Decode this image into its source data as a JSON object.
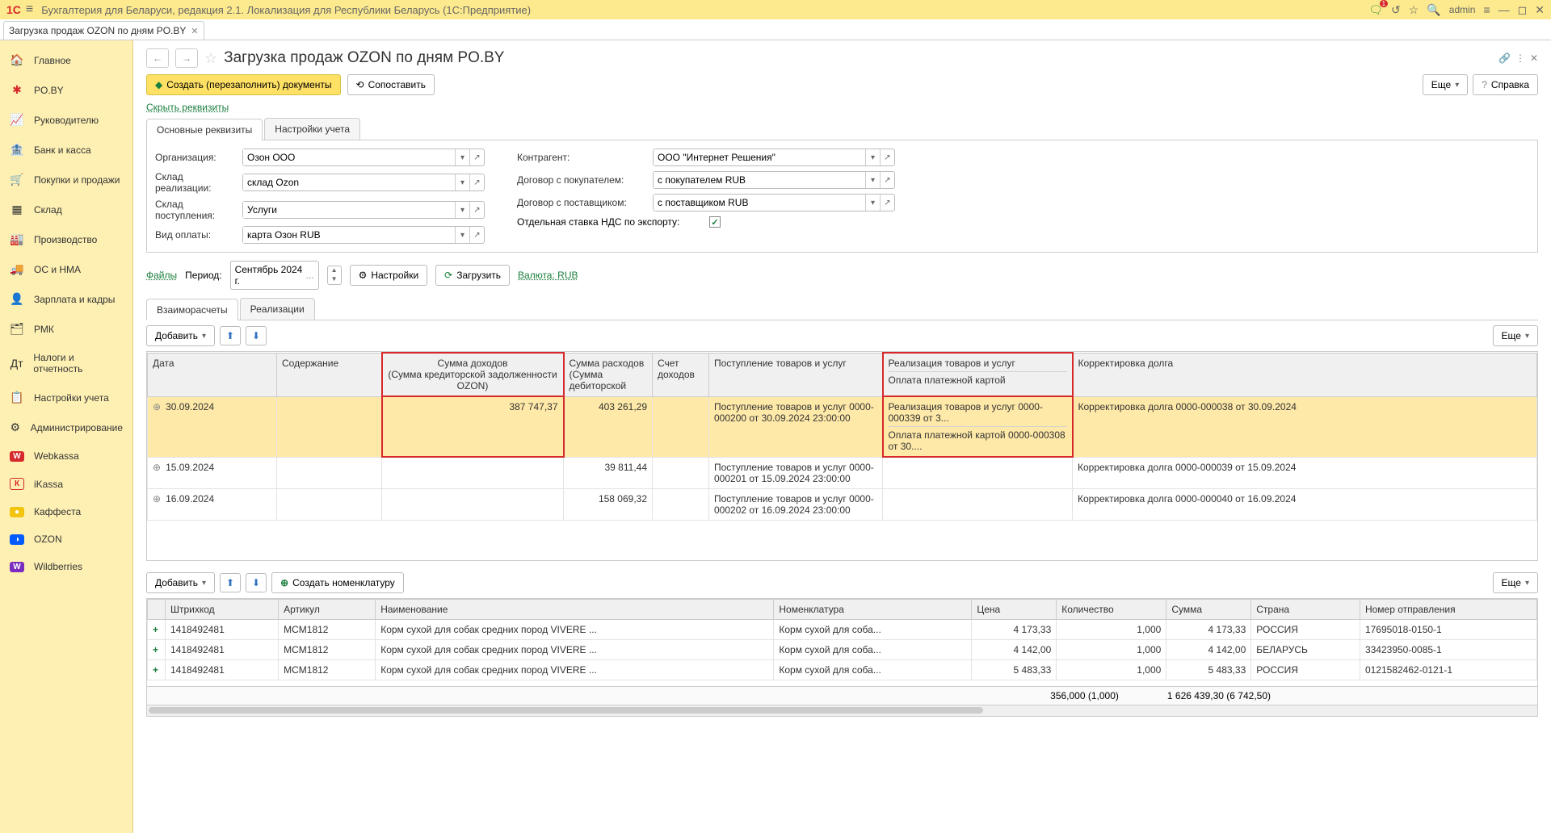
{
  "titlebar": {
    "logo": "1C",
    "title": "Бухгалтерия для Беларуси, редакция 2.1. Локализация для Республики Беларусь   (1С:Предприятие)",
    "user": "admin",
    "notif_count": "1"
  },
  "doc_tab": {
    "title": "Загрузка продаж OZON по дням PO.BY"
  },
  "sidebar": [
    {
      "icon": "🏠",
      "label": "Главное"
    },
    {
      "icon": "✱",
      "label": "PO.BY",
      "accent": "#d6292b"
    },
    {
      "icon": "📈",
      "label": "Руководителю"
    },
    {
      "icon": "🏦",
      "label": "Банк и касса"
    },
    {
      "icon": "🛒",
      "label": "Покупки и продажи"
    },
    {
      "icon": "▦",
      "label": "Склад"
    },
    {
      "icon": "🏭",
      "label": "Производство"
    },
    {
      "icon": "🚚",
      "label": "ОС и НМА"
    },
    {
      "icon": "👤",
      "label": "Зарплата и кадры"
    },
    {
      "icon": "🗂",
      "label": "РМК"
    },
    {
      "icon": "Дт",
      "label": "Налоги и отчетность"
    },
    {
      "icon": "📋",
      "label": "Настройки учета"
    },
    {
      "icon": "⚙",
      "label": "Администрирование"
    },
    {
      "icon": "W",
      "label": "Webkassa",
      "bg": "#d6292b"
    },
    {
      "icon": "К",
      "label": "iKassa",
      "bg": "#e67e22",
      "clr": "#d6292b"
    },
    {
      "icon": "●",
      "label": "Каффеста",
      "bg": "#f3c40f"
    },
    {
      "icon": "◑",
      "label": "OZON",
      "bg": "#005bff"
    },
    {
      "icon": "W",
      "label": "Wildberries",
      "bg": "#7b2cbf"
    }
  ],
  "page": {
    "title": "Загрузка продаж OZON по дням PO.BY",
    "btn_create": "Создать (перезаполнить) документы",
    "btn_compare": "Сопоставить",
    "btn_more": "Еще",
    "btn_help": "Справка",
    "link_hide": "Скрыть реквизиты",
    "link_files": "Файлы",
    "link_currency": "Валюта: RUB"
  },
  "subtabs": [
    "Основные реквизиты",
    "Настройки учета"
  ],
  "form_left": [
    {
      "label": "Организация:",
      "value": "Озон ООО"
    },
    {
      "label": "Склад реализации:",
      "value": "склад Ozon"
    },
    {
      "label": "Склад поступления:",
      "value": "Услуги"
    },
    {
      "label": "Вид оплаты:",
      "value": "карта Озон RUB"
    }
  ],
  "form_right": [
    {
      "label": "Контрагент:",
      "value": "ООО \"Интернет Решения\""
    },
    {
      "label": "Договор с покупателем:",
      "value": "с покупателем RUB"
    },
    {
      "label": "Договор с поставщиком:",
      "value": "с поставщиком RUB"
    }
  ],
  "vat_label": "Отдельная ставка НДС по экспорту:",
  "period": {
    "label": "Период:",
    "value": "Сентябрь 2024 г.",
    "btn_settings": "Настройки",
    "btn_load": "Загрузить"
  },
  "datatabs": [
    "Взаиморасчеты",
    "Реализации"
  ],
  "table_btn_add": "Добавить",
  "table_btn_create_nomen": "Создать номенклатуру",
  "table1": {
    "headers": {
      "date": "Дата",
      "content": "Содержание",
      "income": "Сумма доходов",
      "income_sub": "(Сумма кредиторской задолженности OZON)",
      "expense": "Сумма расходов",
      "expense_sub": "(Сумма дебиторской",
      "acc": "Счет доходов",
      "receipt": "Поступление товаров и услуг",
      "realiz": "Реализация товаров и услуг",
      "realiz_sub": "Оплата платежной картой",
      "correction": "Корректировка долга"
    },
    "rows": [
      {
        "date": "30.09.2024",
        "income": "387 747,37",
        "expense": "403 261,29",
        "receipt": "Поступление товаров и услуг 0000-000200 от 30.09.2024 23:00:00",
        "realiz": "Реализация товаров и услуг 0000-000339 от 3...",
        "realiz2": "Оплата платежной картой 0000-000308 от 30....",
        "corr": "Корректировка долга 0000-000038 от 30.09.2024",
        "sel": true
      },
      {
        "date": "15.09.2024",
        "income": "",
        "expense": "39 811,44",
        "receipt": "Поступление товаров и услуг 0000-000201 от 15.09.2024 23:00:00",
        "realiz": "",
        "realiz2": "",
        "corr": "Корректировка долга 0000-000039 от 15.09.2024"
      },
      {
        "date": "16.09.2024",
        "income": "",
        "expense": "158 069,32",
        "receipt": "Поступление товаров и услуг 0000-000202 от 16.09.2024 23:00:00",
        "realiz": "",
        "realiz2": "",
        "corr": "Корректировка долга 0000-000040 от 16.09.2024"
      }
    ]
  },
  "table2": {
    "headers": [
      "Штрихкод",
      "Артикул",
      "Наименование",
      "Номенклатура",
      "Цена",
      "Количество",
      "Сумма",
      "Страна",
      "Номер отправления"
    ],
    "rows": [
      {
        "bc": "1418492481",
        "art": "MCM1812",
        "name": "Корм сухой для собак средних пород VIVERE ...",
        "nom": "Корм сухой для соба...",
        "price": "4 173,33",
        "qty": "1,000",
        "sum": "4 173,33",
        "country": "РОССИЯ",
        "ship": "17695018-0150-1"
      },
      {
        "bc": "1418492481",
        "art": "MCM1812",
        "name": "Корм сухой для собак средних пород VIVERE ...",
        "nom": "Корм сухой для соба...",
        "price": "4 142,00",
        "qty": "1,000",
        "sum": "4 142,00",
        "country": "БЕЛАРУСЬ",
        "ship": "33423950-0085-1"
      },
      {
        "bc": "1418492481",
        "art": "MCM1812",
        "name": "Корм сухой для собак средних пород VIVERE ...",
        "nom": "Корм сухой для соба...",
        "price": "5 483,33",
        "qty": "1,000",
        "sum": "5 483,33",
        "country": "РОССИЯ",
        "ship": "0121582462-0121-1"
      }
    ],
    "totals": {
      "qty": "356,000 (1,000)",
      "sum": "1 626 439,30 (6 742,50)"
    }
  }
}
